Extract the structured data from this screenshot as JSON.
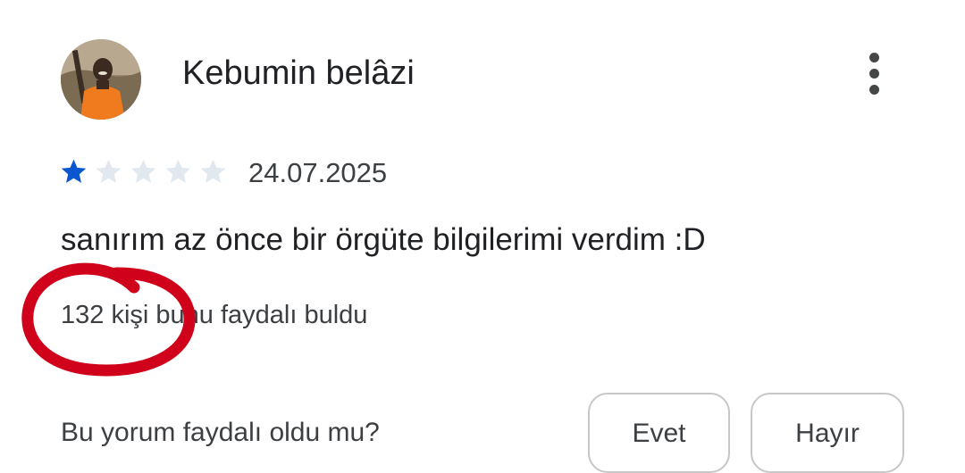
{
  "review": {
    "reviewer_name": "Kebumin belâzi",
    "rating": 1,
    "max_rating": 5,
    "date": "24.07.2025",
    "text": "sanırım az önce bir örgüte bilgilerimi verdim :D",
    "helpful_count_text": "132 kişi bunu faydalı buldu"
  },
  "feedback": {
    "question": "Bu yorum faydalı oldu mu?",
    "yes_label": "Evet",
    "no_label": "Hayır"
  },
  "colors": {
    "star_filled": "#0b57d0",
    "star_empty": "#e1e8f0",
    "annotation": "#d0021b"
  },
  "icons": {
    "more": "more-vert-icon",
    "star": "star-icon"
  }
}
